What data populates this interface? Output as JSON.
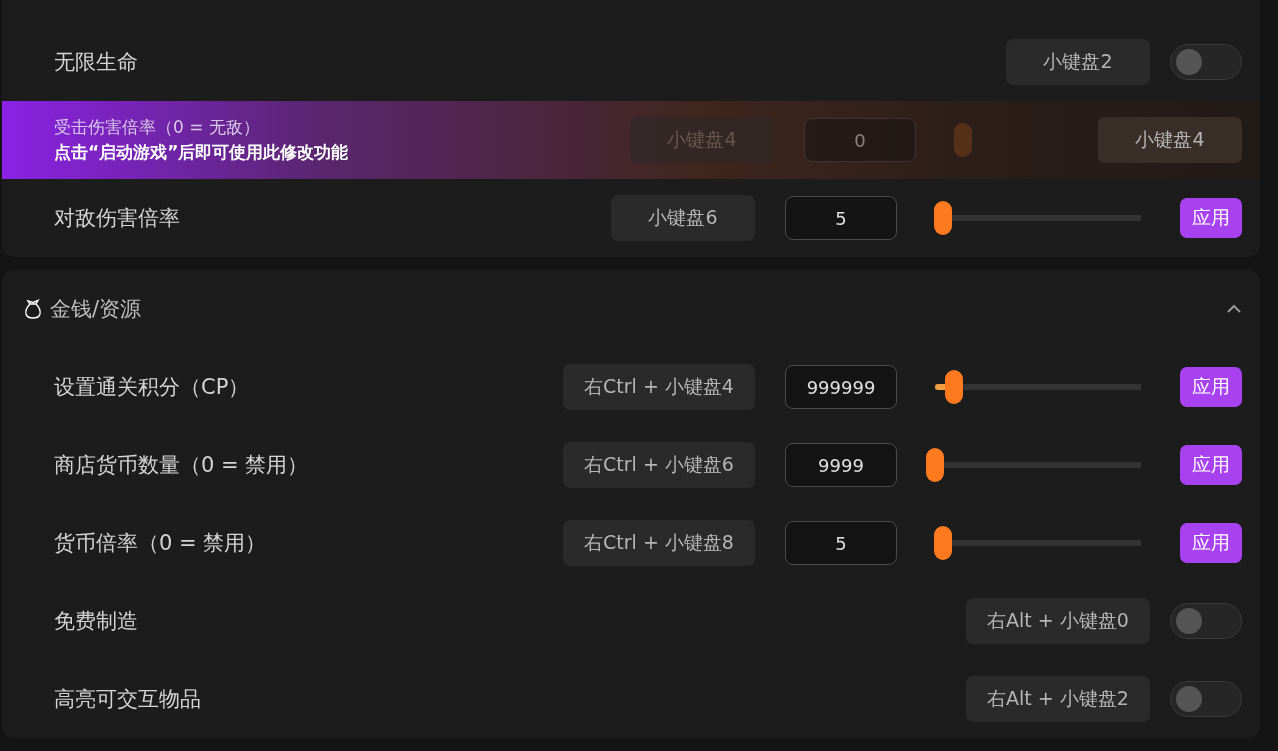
{
  "sections": [
    {
      "rows": [
        {
          "kind": "toggle",
          "label": "无限生命",
          "hotkey": "小键盘2",
          "on": false
        },
        {
          "kind": "locked",
          "label": "受击伤害倍率（0 = 无敌）",
          "notice": "点击“启动游戏”后即可使用此修改功能",
          "hotkey": "小键盘4",
          "value": "0",
          "hotkey_2": "小键盘4"
        },
        {
          "kind": "slider",
          "label": "对敌伤害倍率",
          "hotkey": "小键盘6",
          "value": "5",
          "level": 0.04,
          "button": "应用"
        }
      ]
    },
    {
      "title": "金钱/资源",
      "expanded": true,
      "rows": [
        {
          "kind": "slider",
          "label": "设置通关积分（CP）",
          "hotkey": "右Ctrl + 小键盘4",
          "value": "999999",
          "level": 0.09,
          "button": "应用"
        },
        {
          "kind": "slider",
          "label": "商店货币数量（0 = 禁用）",
          "hotkey": "右Ctrl + 小键盘6",
          "value": "9999",
          "level": 0.0,
          "button": "应用"
        },
        {
          "kind": "slider",
          "label": "货币倍率（0 = 禁用）",
          "hotkey": "右Ctrl + 小键盘8",
          "value": "5",
          "level": 0.04,
          "button": "应用"
        },
        {
          "kind": "toggle",
          "label": "免费制造",
          "hotkey": "右Alt + 小键盘0",
          "on": false
        },
        {
          "kind": "toggle",
          "label": "高亮可交互物品",
          "hotkey": "右Alt + 小键盘2",
          "on": false
        }
      ]
    }
  ]
}
